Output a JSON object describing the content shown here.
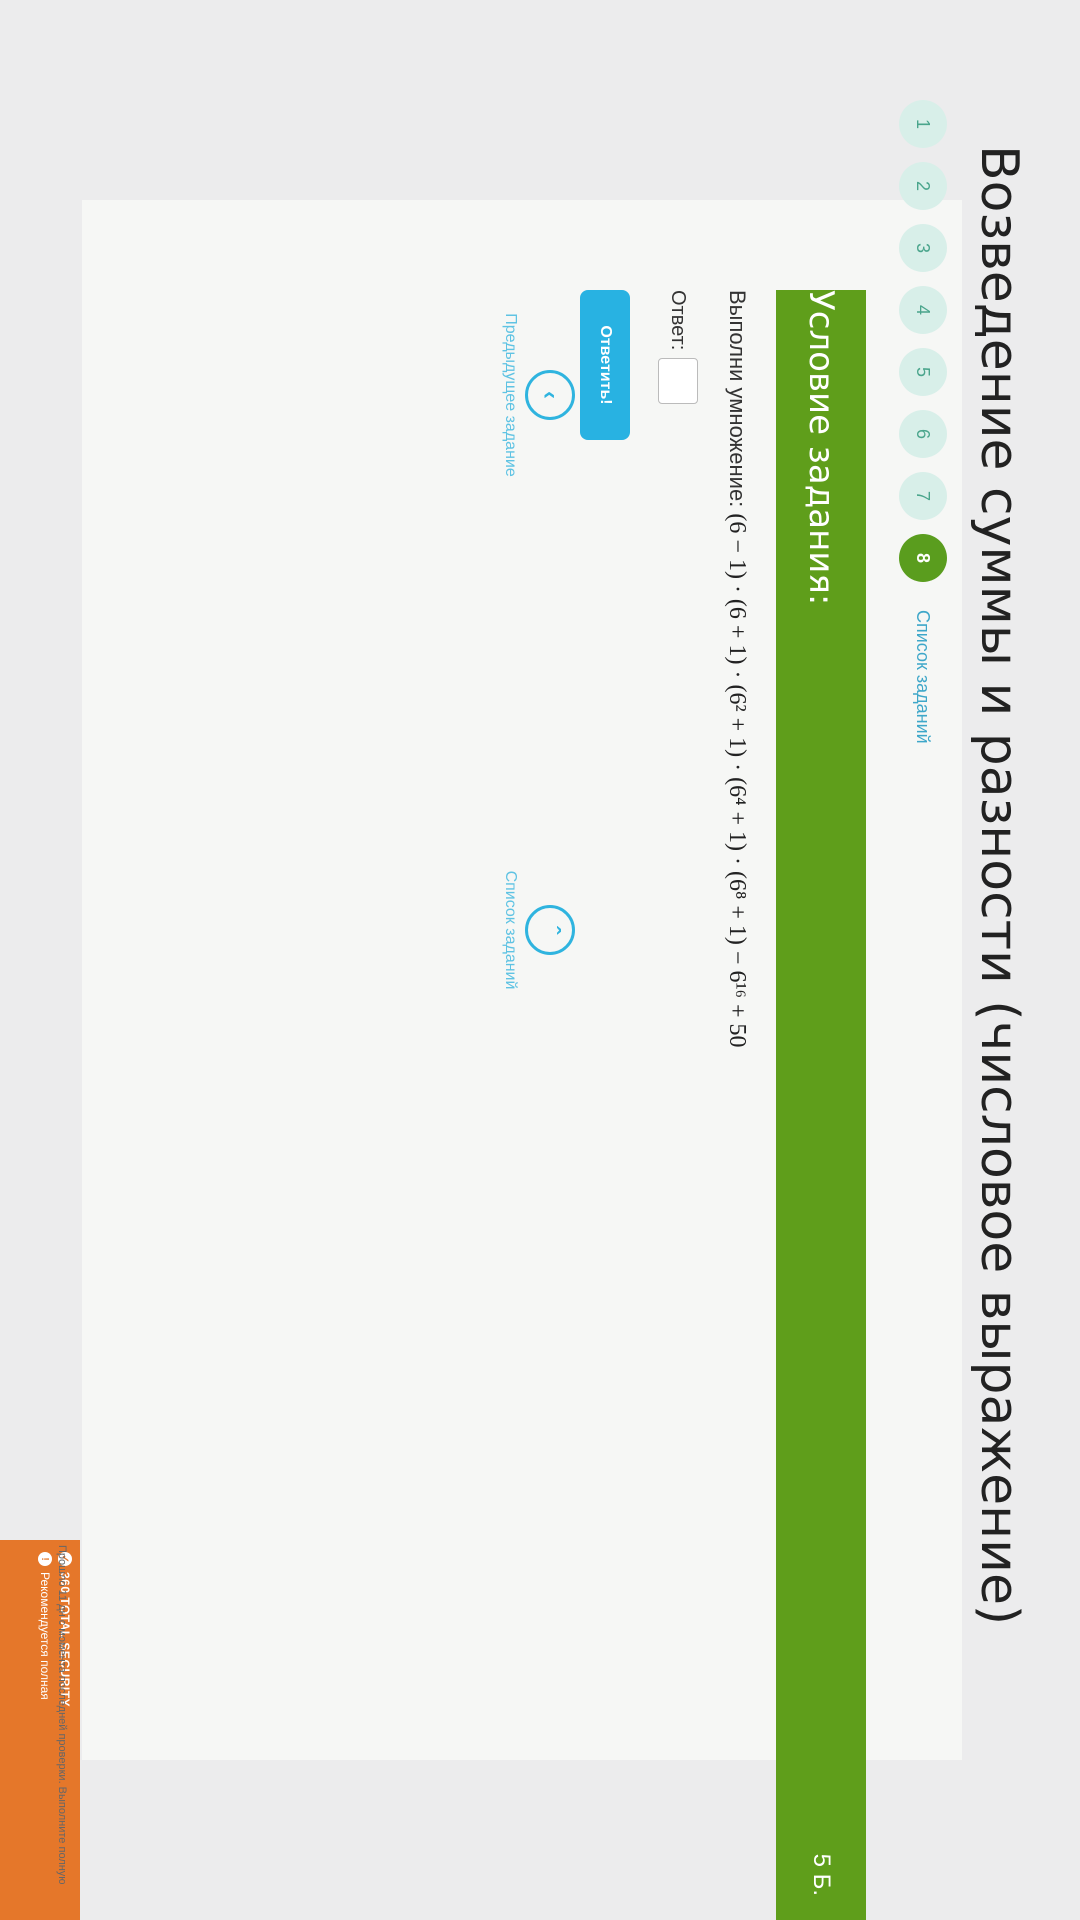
{
  "page": {
    "title": "Возведение суммы и разности (числовое выражение)"
  },
  "steps": [
    {
      "label": "1",
      "active": false
    },
    {
      "label": "2",
      "active": false
    },
    {
      "label": "3",
      "active": false
    },
    {
      "label": "4",
      "active": false
    },
    {
      "label": "5",
      "active": false
    },
    {
      "label": "6",
      "active": false
    },
    {
      "label": "7",
      "active": false
    },
    {
      "label": "8",
      "active": true
    }
  ],
  "task_list_link": "Список заданий",
  "header": {
    "title": "Условие задания:",
    "points": "5 Б."
  },
  "task": {
    "prefix": "Выполни умножение:",
    "expression": "(6 − 1) · (6 + 1) · (6² + 1) · (6⁴ + 1) · (6⁸ + 1) − 6¹⁶ + 50"
  },
  "answer": {
    "label": "Ответ:",
    "value": ""
  },
  "buttons": {
    "submit": "Ответить!"
  },
  "nav": {
    "previous_label": "Предыдущее задание",
    "previous_icon": "chevron-left-icon",
    "list_label": "Список заданий",
    "list_icon": "chevron-up-icon"
  },
  "notification": {
    "brand": "360 TOTAL SECURITY",
    "recommendation": "Рекомендуется полная",
    "detail": "Прошло 11 дн с момента последней проверки. Выполните полную"
  },
  "colors": {
    "header_green": "#5f9e1b",
    "step_active": "#5a9d1e",
    "accent_blue": "#28b2e2",
    "notice_orange": "#e5772a"
  }
}
